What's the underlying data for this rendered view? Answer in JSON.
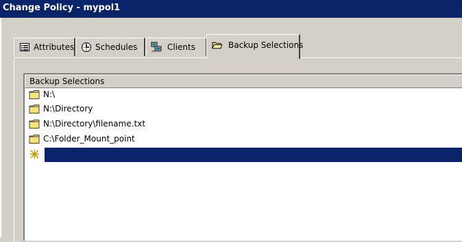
{
  "window": {
    "title": "Change Policy - mypol1"
  },
  "tabs": [
    {
      "label": "Attributes",
      "icon": "list-icon"
    },
    {
      "label": "Schedules",
      "icon": "clock-icon"
    },
    {
      "label": "Clients",
      "icon": "computers-icon"
    },
    {
      "label": "Backup Selections",
      "icon": "folder-open-icon",
      "active": true
    }
  ],
  "list": {
    "header": "Backup Selections",
    "rows": [
      {
        "text": "N:\\",
        "icon": "folder-icon"
      },
      {
        "text": "N:\\Directory",
        "icon": "folder-icon"
      },
      {
        "text": "N:\\Directory\\filename.txt",
        "icon": "folder-icon"
      },
      {
        "text": "C:\\Folder_Mount_point",
        "icon": "folder-icon"
      },
      {
        "text": "",
        "icon": "new-entry-icon",
        "selected": true
      }
    ]
  },
  "colors": {
    "title_bar": "#0a246a",
    "selection": "#0a246a",
    "face": "#d4d0c8",
    "folder": "#f6d85a"
  }
}
